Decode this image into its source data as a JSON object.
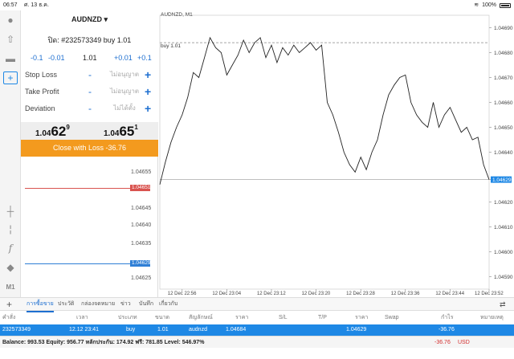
{
  "status_bar": {
    "time": "06:57",
    "date": "ศ. 13 ธ.ค.",
    "wifi_icon": "wifi-icon",
    "battery": "100%"
  },
  "toolbar": {
    "icons": [
      "user-icon",
      "trade-up-icon",
      "chat-icon",
      "new-order-icon",
      "crosshair-icon",
      "indicators-icon",
      "function-icon",
      "objects-icon"
    ],
    "timeframe": "M1"
  },
  "order": {
    "symbol": "AUDNZD",
    "ticket": "ปิด: #232573349 buy 1.01",
    "steps": {
      "minus_big": "-0.1",
      "minus_small": "-0.01",
      "volume": "1.01",
      "plus_small": "+0.01",
      "plus_big": "+0.1"
    },
    "rows": [
      {
        "label": "Stop Loss",
        "value": "ไม่อนุญาต"
      },
      {
        "label": "Take Profit",
        "value": "ไม่อนุญาต"
      },
      {
        "label": "Deviation",
        "value": "ไม่ได้ตั้ง"
      }
    ],
    "minus_sign": "-",
    "plus_sign": "+",
    "bid": {
      "prefix": "1.04",
      "big": "62",
      "sup": "9"
    },
    "ask": {
      "prefix": "1.04",
      "big": "65",
      "sup": "1"
    },
    "close_button": "Close with Loss -36.76"
  },
  "mini_chart": {
    "ticks": [
      "1.04655",
      "1.04651",
      "1.04645",
      "1.04640",
      "1.04635",
      "1.04629",
      "1.04625"
    ],
    "ask_tag": "1.04651",
    "bid_tag": "1.04629",
    "colors": {
      "ask": "#d9534f",
      "bid": "#2f7fd6"
    }
  },
  "chart": {
    "label": "AUDNZD, M1",
    "buy_label": "buy 1.01",
    "y_ticks": [
      "1.04690",
      "1.04680",
      "1.04670",
      "1.04660",
      "1.04650",
      "1.04640",
      "1.04629",
      "1.04620",
      "1.04610",
      "1.04600",
      "1.04590"
    ],
    "current_tag": "1.04629",
    "x_ticks": [
      "12 Dec 22:56",
      "12 Dec 23:04",
      "12 Dec 23:12",
      "12 Dec 23:20",
      "12 Dec 23:28",
      "12 Dec 23:36",
      "12 Dec 23:44",
      "12 Dec 23:52"
    ]
  },
  "chart_data": {
    "type": "line",
    "title": "AUDNZD, M1",
    "xlabel": "",
    "ylabel": "",
    "ylim": [
      1.04585,
      1.04695
    ],
    "x": [
      "22:52",
      "22:53",
      "22:54",
      "22:55",
      "22:56",
      "22:57",
      "22:58",
      "22:59",
      "23:00",
      "23:01",
      "23:02",
      "23:03",
      "23:04",
      "23:05",
      "23:06",
      "23:07",
      "23:08",
      "23:09",
      "23:10",
      "23:11",
      "23:12",
      "23:13",
      "23:14",
      "23:15",
      "23:16",
      "23:17",
      "23:18",
      "23:19",
      "23:20",
      "23:21",
      "23:22",
      "23:23",
      "23:24",
      "23:25",
      "23:26",
      "23:27",
      "23:28",
      "23:29",
      "23:30",
      "23:31",
      "23:32",
      "23:33",
      "23:34",
      "23:35",
      "23:36",
      "23:37",
      "23:38",
      "23:39",
      "23:40",
      "23:41",
      "23:42",
      "23:43",
      "23:44",
      "23:45",
      "23:46",
      "23:47",
      "23:48",
      "23:49",
      "23:50",
      "23:51"
    ],
    "series": [
      {
        "values": [
          1.04627,
          1.04636,
          1.04644,
          1.0465,
          1.04655,
          1.04662,
          1.04672,
          1.0467,
          1.04678,
          1.04686,
          1.04682,
          1.0468,
          1.04671,
          1.04675,
          1.04679,
          1.04685,
          1.0468,
          1.04684,
          1.04686,
          1.04678,
          1.04683,
          1.04676,
          1.04682,
          1.04679,
          1.04683,
          1.0468,
          1.04682,
          1.04684,
          1.04681,
          1.04683,
          1.0466,
          1.04655,
          1.04648,
          1.0464,
          1.04635,
          1.04632,
          1.04638,
          1.04633,
          1.0464,
          1.04645,
          1.04655,
          1.04663,
          1.04667,
          1.0467,
          1.04671,
          1.0466,
          1.04655,
          1.04652,
          1.0465,
          1.0466,
          1.0465,
          1.04655,
          1.04658,
          1.04653,
          1.04648,
          1.0465,
          1.04645,
          1.04646,
          1.04635,
          1.04629
        ]
      }
    ],
    "buy_level": 1.04684,
    "current_level": 1.04629,
    "grid": false,
    "colors": {
      "line": "#222222",
      "buy_line": "#888888",
      "current": "#1e88e5"
    }
  },
  "tabs": {
    "add": "+",
    "items": [
      "การซื้อขาย",
      "ประวัติ",
      "กล่องจดหมาย",
      "ข่าว",
      "บันทึก",
      "เกี่ยวกับ"
    ]
  },
  "table": {
    "headers": [
      "คำสั่ง",
      "เวลา",
      "ประเภท",
      "ขนาด",
      "สัญลักษณ์",
      "ราคา",
      "S/L",
      "T/P",
      "ราคา",
      "Swap",
      "กำไร",
      "หมายเหตุ"
    ],
    "row": [
      "232573349",
      "12.12 23:41",
      "buy",
      "1.01",
      "audnzd",
      "1.04684",
      "",
      "",
      "1.04629",
      "",
      "-36.76",
      ""
    ]
  },
  "balance": {
    "text": "Balance: 993.53 Equity: 956.77 หลักประกัน: 174.92 ฟรี: 781.85 Level: 546.97%",
    "profit": "-36.76",
    "currency": "USD"
  }
}
